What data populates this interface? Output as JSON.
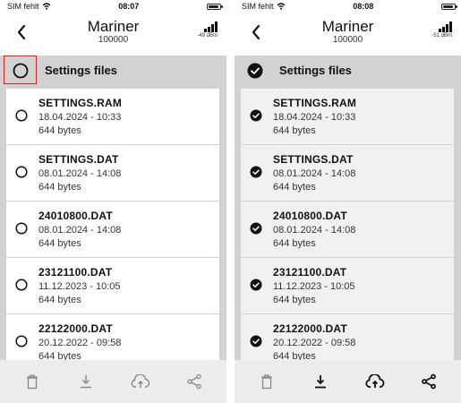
{
  "colors": {
    "highlight": "#e0201e",
    "list_bg": "#d2d2d2",
    "toolbar_bg": "#ececec"
  },
  "screens": [
    {
      "status": {
        "carrier": "SIM fehlt",
        "time": "08:07"
      },
      "nav": {
        "title": "Mariner",
        "subtitle": "100000",
        "signal_dbm": "-49 dBm"
      },
      "header": {
        "label": "Settings files",
        "checked": false
      },
      "files": [
        {
          "name": "SETTINGS.RAM",
          "date": "18.04.2024 - 10:33",
          "size": "644 bytes"
        },
        {
          "name": "SETTINGS.DAT",
          "date": "08.01.2024 - 14:08",
          "size": "644 bytes"
        },
        {
          "name": "24010800.DAT",
          "date": "08.01.2024 - 14:08",
          "size": "644 bytes"
        },
        {
          "name": "23121100.DAT",
          "date": "11.12.2023 - 10:05",
          "size": "644 bytes"
        },
        {
          "name": "22122000.DAT",
          "date": "20.12.2022 - 09:58",
          "size": "644 bytes"
        }
      ],
      "toolbar": [
        "trash-icon",
        "download-icon",
        "cloud-upload-icon",
        "share-icon"
      ]
    },
    {
      "status": {
        "carrier": "SIM fehlt",
        "time": "08:08"
      },
      "nav": {
        "title": "Mariner",
        "subtitle": "100000",
        "signal_dbm": "-51 dBm"
      },
      "header": {
        "label": "Settings files",
        "checked": true
      },
      "files": [
        {
          "name": "SETTINGS.RAM",
          "date": "18.04.2024 - 10:33",
          "size": "644 bytes"
        },
        {
          "name": "SETTINGS.DAT",
          "date": "08.01.2024 - 14:08",
          "size": "644 bytes"
        },
        {
          "name": "24010800.DAT",
          "date": "08.01.2024 - 14:08",
          "size": "644 bytes"
        },
        {
          "name": "23121100.DAT",
          "date": "11.12.2023 - 10:05",
          "size": "644 bytes"
        },
        {
          "name": "22122000.DAT",
          "date": "20.12.2022 - 09:58",
          "size": "644 bytes"
        }
      ],
      "toolbar": [
        "trash-icon",
        "download-icon",
        "cloud-upload-icon",
        "share-icon"
      ]
    }
  ]
}
